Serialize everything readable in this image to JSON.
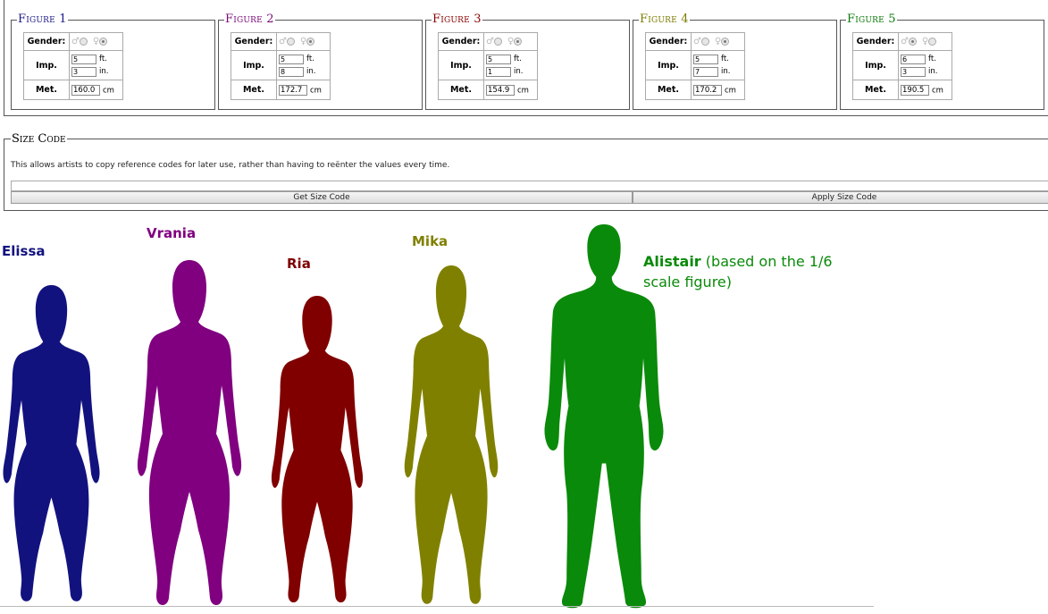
{
  "figures": [
    {
      "legend": "Figure 1",
      "color": "#1a1a8a",
      "gender_label": "Gender:",
      "male_symbol": "♂",
      "female_symbol": "♀",
      "gender": "female",
      "imp_label": "Imp.",
      "feet": "5",
      "feet_unit": "ft.",
      "inches": "3",
      "inch_unit": "in.",
      "met_label": "Met.",
      "cm": "160.0",
      "cm_unit": "cm"
    },
    {
      "legend": "Figure 2",
      "color": "#7a0a7a",
      "gender_label": "Gender:",
      "male_symbol": "♂",
      "female_symbol": "♀",
      "gender": "female",
      "imp_label": "Imp.",
      "feet": "5",
      "feet_unit": "ft.",
      "inches": "8",
      "inch_unit": "in.",
      "met_label": "Met.",
      "cm": "172.7",
      "cm_unit": "cm"
    },
    {
      "legend": "Figure 3",
      "color": "#8a0000",
      "gender_label": "Gender:",
      "male_symbol": "♂",
      "female_symbol": "♀",
      "gender": "female",
      "imp_label": "Imp.",
      "feet": "5",
      "feet_unit": "ft.",
      "inches": "1",
      "inch_unit": "in.",
      "met_label": "Met.",
      "cm": "154.9",
      "cm_unit": "cm"
    },
    {
      "legend": "Figure 4",
      "color": "#7a7a00",
      "gender_label": "Gender:",
      "male_symbol": "♂",
      "female_symbol": "♀",
      "gender": "female",
      "imp_label": "Imp.",
      "feet": "5",
      "feet_unit": "ft.",
      "inches": "7",
      "inch_unit": "in.",
      "met_label": "Met.",
      "cm": "170.2",
      "cm_unit": "cm"
    },
    {
      "legend": "Figure 5",
      "color": "#0a7a0a",
      "gender_label": "Gender:",
      "male_symbol": "♂",
      "female_symbol": "♀",
      "gender": "male",
      "imp_label": "Imp.",
      "feet": "6",
      "feet_unit": "ft.",
      "inches": "3",
      "inch_unit": "in.",
      "met_label": "Met.",
      "cm": "190.5",
      "cm_unit": "cm"
    }
  ],
  "size_code": {
    "legend": "Size Code",
    "description": "This allows artists to copy reference codes for later use, rather than having to reënter the values every time.",
    "get_button": "Get Size Code",
    "apply_button": "Apply Size Code"
  },
  "silhouettes": [
    {
      "name": "Elissa",
      "note": "",
      "color": "#12127f"
    },
    {
      "name": "Vrania",
      "note": "",
      "color": "#800080"
    },
    {
      "name": "Ria",
      "note": "",
      "color": "#800000"
    },
    {
      "name": "Mika",
      "note": "",
      "color": "#808000"
    },
    {
      "name": "Alistair",
      "note": " (based on the 1/6 scale figure)",
      "color": "#0a8a0a"
    }
  ]
}
